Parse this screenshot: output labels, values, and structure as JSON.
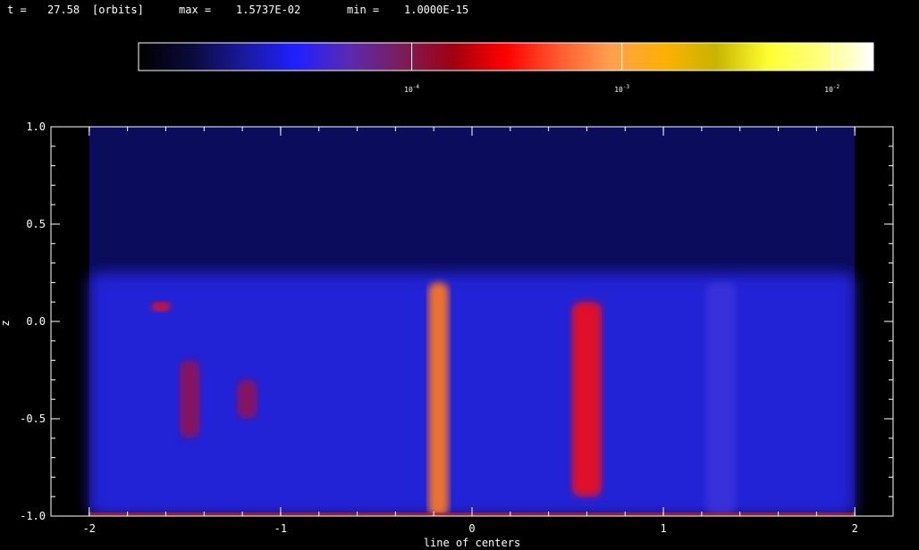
{
  "header": {
    "time_label": "t =",
    "time_value": "27.58",
    "time_unit": "[orbits]",
    "max_label": "max =",
    "max_value": "1.5737E-02",
    "min_label": "min =",
    "min_value": "1.0000E-15"
  },
  "colorbar": {
    "ticks": [
      {
        "label": "10",
        "exp": "-4",
        "value": 0.0001
      },
      {
        "label": "10",
        "exp": "-3",
        "value": 0.001
      },
      {
        "label": "10",
        "exp": "-2",
        "value": 0.01
      }
    ],
    "colors": [
      "#000000",
      "#0a0a3a",
      "#1a1a9c",
      "#2020ff",
      "#5a2ab0",
      "#7a1e5a",
      "#a00010",
      "#ff0000",
      "#ff5a30",
      "#ffa050",
      "#ffb000",
      "#c8b400",
      "#ffff30",
      "#ffff80",
      "#ffffff"
    ]
  },
  "chart_data": {
    "type": "heatmap",
    "xlabel": "line of centers",
    "ylabel": "z",
    "xlim": [
      -2.2,
      2.2
    ],
    "ylim": [
      -1.0,
      1.0
    ],
    "xticks": [
      "-2",
      "-1",
      "0",
      "1",
      "2"
    ],
    "xtick_values": [
      -2,
      -1,
      0,
      1,
      2
    ],
    "yticks": [
      "1.0",
      "0.5",
      "0.0",
      "-0.5",
      "-1.0"
    ],
    "ytick_values": [
      1.0,
      0.5,
      0.0,
      -0.5,
      -1.0
    ],
    "data_extent_x": [
      -2.0,
      2.0
    ],
    "background_level": "low",
    "features": [
      {
        "x": [
          -2.0,
          2.0
        ],
        "z": [
          -1.0,
          0.25
        ],
        "level": "blue"
      },
      {
        "x": [
          -1.65,
          -1.6
        ],
        "z": [
          0.05,
          0.1
        ],
        "level": "red"
      },
      {
        "x": [
          -1.5,
          -1.45
        ],
        "z": [
          -0.6,
          -0.2
        ],
        "level": "dark-red"
      },
      {
        "x": [
          -1.2,
          -1.15
        ],
        "z": [
          -0.5,
          -0.3
        ],
        "level": "dark-red"
      },
      {
        "x": [
          -0.2,
          -0.15
        ],
        "z": [
          -1.0,
          0.2
        ],
        "level": "orange"
      },
      {
        "x": [
          0.55,
          0.65
        ],
        "z": [
          -0.9,
          0.1
        ],
        "level": "red"
      },
      {
        "x": [
          1.25,
          1.35
        ],
        "z": [
          -1.0,
          0.2
        ],
        "level": "violet"
      }
    ]
  }
}
